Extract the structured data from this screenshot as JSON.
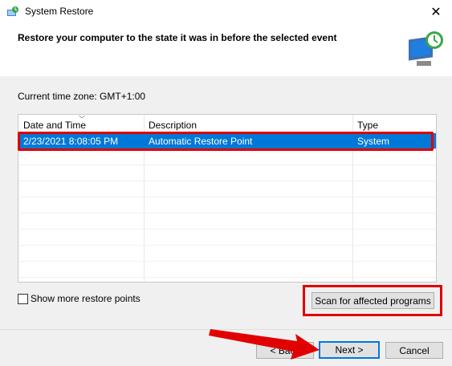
{
  "window": {
    "title": "System Restore",
    "close_glyph": "✕"
  },
  "header": {
    "heading": "Restore your computer to the state it was in before the selected event"
  },
  "timezone": "Current time zone: GMT+1:00",
  "table": {
    "columns": [
      "Date and Time",
      "Description",
      "Type"
    ],
    "rows": [
      {
        "date": "2/23/2021 8:08:05 PM",
        "description": "Automatic Restore Point",
        "type": "System",
        "selected": true
      }
    ]
  },
  "options": {
    "show_more_label": "Show more restore points",
    "show_more_checked": false
  },
  "buttons": {
    "scan": "Scan for affected programs",
    "back": "< Back",
    "next": "Next >",
    "cancel": "Cancel"
  },
  "colors": {
    "selection": "#0078d7",
    "highlight": "#e00000"
  },
  "icons": [
    "system-restore-icon",
    "close-icon",
    "sort-chevron-icon",
    "restore-computer-icon"
  ]
}
